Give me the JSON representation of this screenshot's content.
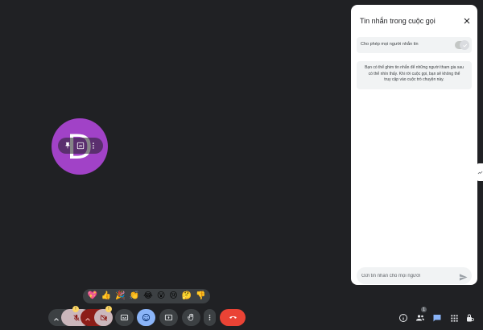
{
  "participant": {
    "initial": "D",
    "avatar_color": "#a142c7"
  },
  "hover_actions": [
    {
      "icon": "pin-icon"
    },
    {
      "icon": "frame-icon"
    },
    {
      "icon": "more-vert-icon"
    }
  ],
  "panel": {
    "title": "Tin nhắn trong cuộc gọi",
    "toggle_label": "Cho phép mọi người nhắn tin",
    "toggle_on": true,
    "info_text": "Bạn có thể ghim tin nhắn để những người tham gia sau có thể nhìn thấy. Khi rời cuộc gọi, bạn sẽ không thể truy cập vào cuộc trò chuyện này.",
    "input_placeholder": "Gửi tin nhắn cho mọi người"
  },
  "reactions": [
    "💖",
    "👍",
    "🎉",
    "👏",
    "😂",
    "😮",
    "😢",
    "🤔",
    "👎"
  ],
  "controls": {
    "mic_badge": "!",
    "camera_badge": "!",
    "people_count": "1"
  },
  "colors": {
    "background": "#202124",
    "control_bg": "#3c4043",
    "end_call": "#ea4335",
    "active_control": "#8ab4f8",
    "accent": "#8ab4f8",
    "mic_bg": "#cbb7bc",
    "cam_bg": "#8c1d18"
  }
}
